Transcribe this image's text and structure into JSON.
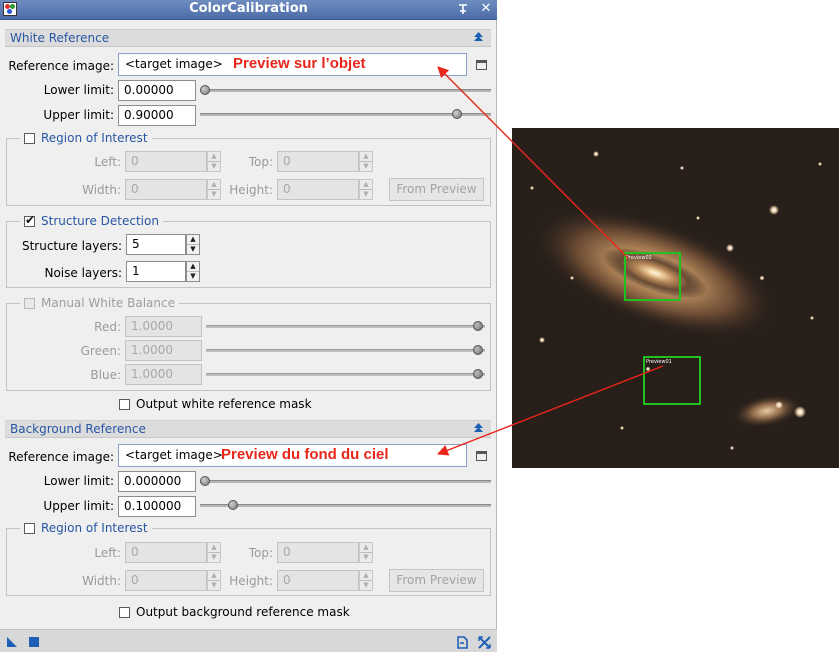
{
  "window": {
    "title": "ColorCalibration",
    "pin_glyph": "⌯",
    "close_glyph": "✕"
  },
  "white_reference": {
    "section_label": "White Reference",
    "reference_image_label": "Reference image:",
    "reference_image_value": "<target image>",
    "annotation": "Preview sur l’objet",
    "lower_limit_label": "Lower limit:",
    "lower_limit_value": "0.00000",
    "lower_limit_slider": 0.0,
    "upper_limit_label": "Upper limit:",
    "upper_limit_value": "0.90000",
    "upper_limit_slider": 0.9,
    "roi": {
      "title": "Region of Interest",
      "checked": false,
      "left_label": "Left:",
      "left_value": "0",
      "top_label": "Top:",
      "top_value": "0",
      "width_label": "Width:",
      "width_value": "0",
      "height_label": "Height:",
      "height_value": "0",
      "from_preview_label": "From Preview"
    },
    "structure_detection": {
      "title": "Structure Detection",
      "checked": true,
      "structure_layers_label": "Structure layers:",
      "structure_layers_value": "5",
      "noise_layers_label": "Noise layers:",
      "noise_layers_value": "1"
    },
    "manual_white_balance": {
      "title": "Manual White Balance",
      "checked": false,
      "red_label": "Red:",
      "red_value": "1.0000",
      "red_slider": 1.0,
      "green_label": "Green:",
      "green_value": "1.0000",
      "green_slider": 1.0,
      "blue_label": "Blue:",
      "blue_value": "1.0000",
      "blue_slider": 1.0
    },
    "output_mask_label": "Output white reference mask",
    "output_mask_checked": false
  },
  "background_reference": {
    "section_label": "Background Reference",
    "reference_image_label": "Reference image:",
    "reference_image_value": "<target image>",
    "annotation": "Preview du fond du ciel",
    "lower_limit_label": "Lower limit:",
    "lower_limit_value": "0.000000",
    "lower_limit_slider": 0.0,
    "upper_limit_label": "Upper limit:",
    "upper_limit_value": "0.100000",
    "upper_limit_slider": 0.1,
    "roi": {
      "title": "Region of Interest",
      "checked": false,
      "left_label": "Left:",
      "left_value": "0",
      "top_label": "Top:",
      "top_value": "0",
      "width_label": "Width:",
      "width_value": "0",
      "height_label": "Height:",
      "height_value": "0",
      "from_preview_label": "From Preview"
    },
    "output_mask_label": "Output background reference mask",
    "output_mask_checked": false
  },
  "image_previews": {
    "object_preview_label": "Preview02",
    "sky_preview_label": "Preview01"
  },
  "colors": {
    "annotation": "#e8261b",
    "preview_box": "#21c21f",
    "section_text": "#2856a4",
    "titlebar": "#5876b0"
  },
  "icons": {
    "app": "process-icon",
    "collapse": "collapse-up-icon",
    "view_list": "view-list-icon",
    "new_instance": "new-instance-triangle-icon",
    "apply_global": "apply-global-square-icon",
    "reset": "reset-icon",
    "preferences": "preferences-icon"
  }
}
